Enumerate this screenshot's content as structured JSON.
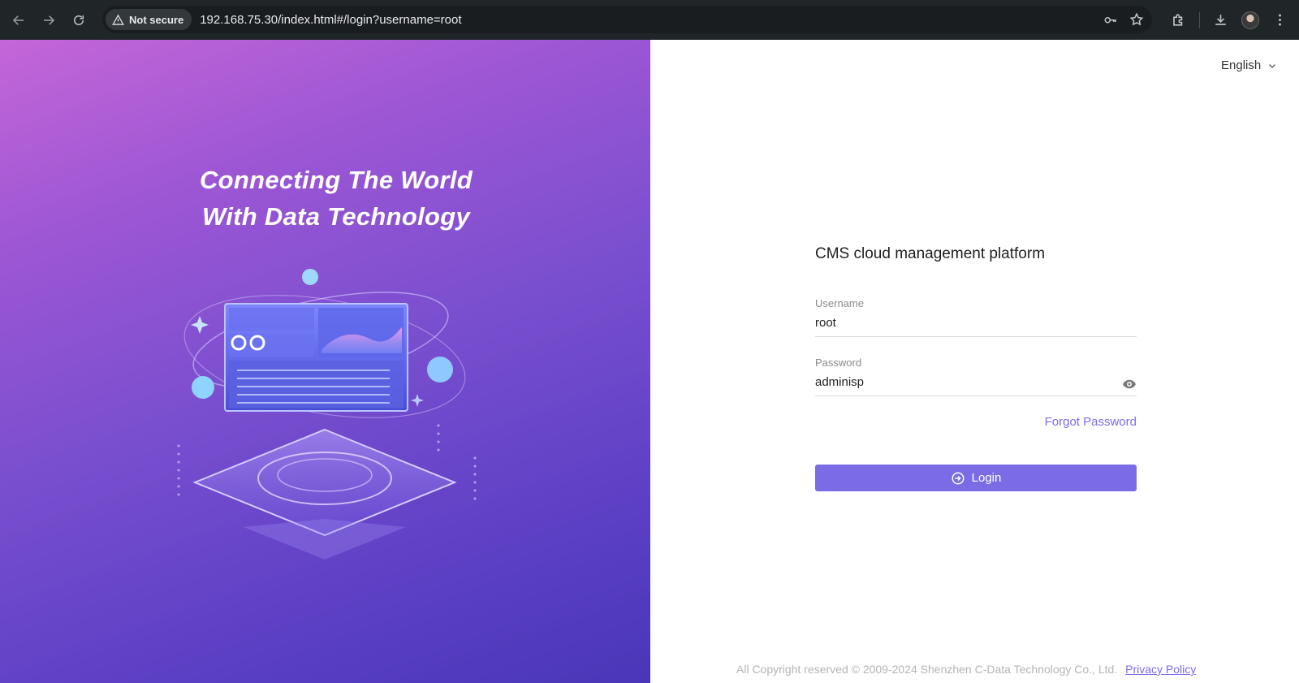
{
  "browser": {
    "security_label": "Not secure",
    "url": "192.168.75.30/index.html#/login?username=root"
  },
  "hero": {
    "title_line1": "Connecting The World",
    "title_line2": "With Data Technology"
  },
  "header": {
    "language": "English"
  },
  "login": {
    "title": "CMS cloud management platform",
    "username_label": "Username",
    "username_value": "root",
    "password_label": "Password",
    "password_value": "adminisp",
    "forgot_label": "Forgot Password",
    "login_label": "Login"
  },
  "footer": {
    "copyright": "All Copyright reserved © 2009-2024 Shenzhen C-Data Technology Co., Ltd.",
    "privacy_label": "Privacy Policy"
  },
  "colors": {
    "accent": "#7b6ce6",
    "hero_start": "#c466d8",
    "hero_end": "#4a36b8",
    "chrome_bg": "#202628"
  }
}
